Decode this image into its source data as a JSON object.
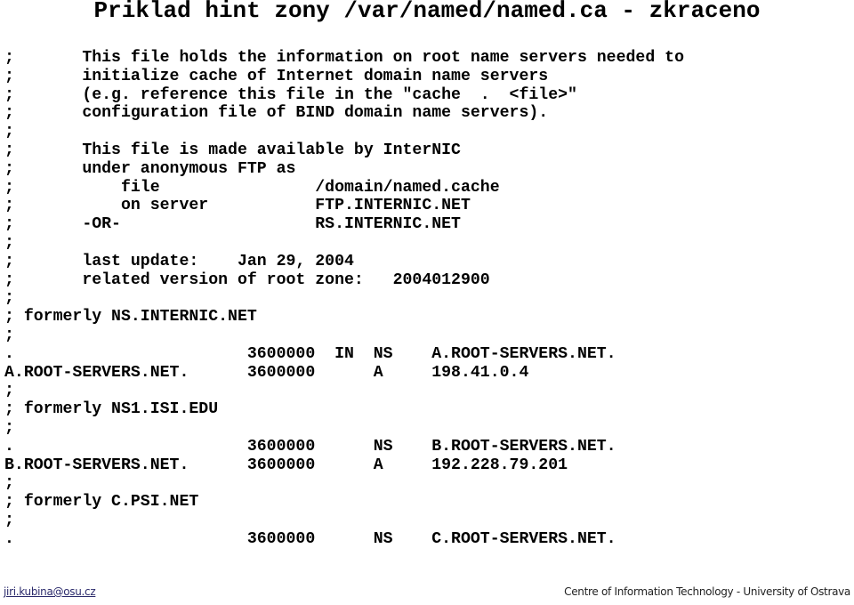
{
  "title": "Priklad hint zony /var/named/named.ca - zkraceno",
  "lines": [
    ";       This file holds the information on root name servers needed to",
    ";       initialize cache of Internet domain name servers",
    ";       (e.g. reference this file in the \"cache  .  <file>\"",
    ";       configuration file of BIND domain name servers).",
    ";",
    ";       This file is made available by InterNIC",
    ";       under anonymous FTP as",
    ";           file                /domain/named.cache",
    ";           on server           FTP.INTERNIC.NET",
    ";       -OR-                    RS.INTERNIC.NET",
    ";",
    ";       last update:    Jan 29, 2004",
    ";       related version of root zone:   2004012900",
    ";",
    "; formerly NS.INTERNIC.NET",
    ";",
    ".                        3600000  IN  NS    A.ROOT-SERVERS.NET.",
    "A.ROOT-SERVERS.NET.      3600000      A     198.41.0.4",
    ";",
    "; formerly NS1.ISI.EDU",
    ";",
    ".                        3600000      NS    B.ROOT-SERVERS.NET.",
    "B.ROOT-SERVERS.NET.      3600000      A     192.228.79.201",
    ";",
    "; formerly C.PSI.NET",
    ";",
    ".                        3600000      NS    C.ROOT-SERVERS.NET."
  ],
  "footer": {
    "email": "jiri.kubina@osu.cz",
    "organization": "Centre of Information Technology - University of Ostrava"
  }
}
